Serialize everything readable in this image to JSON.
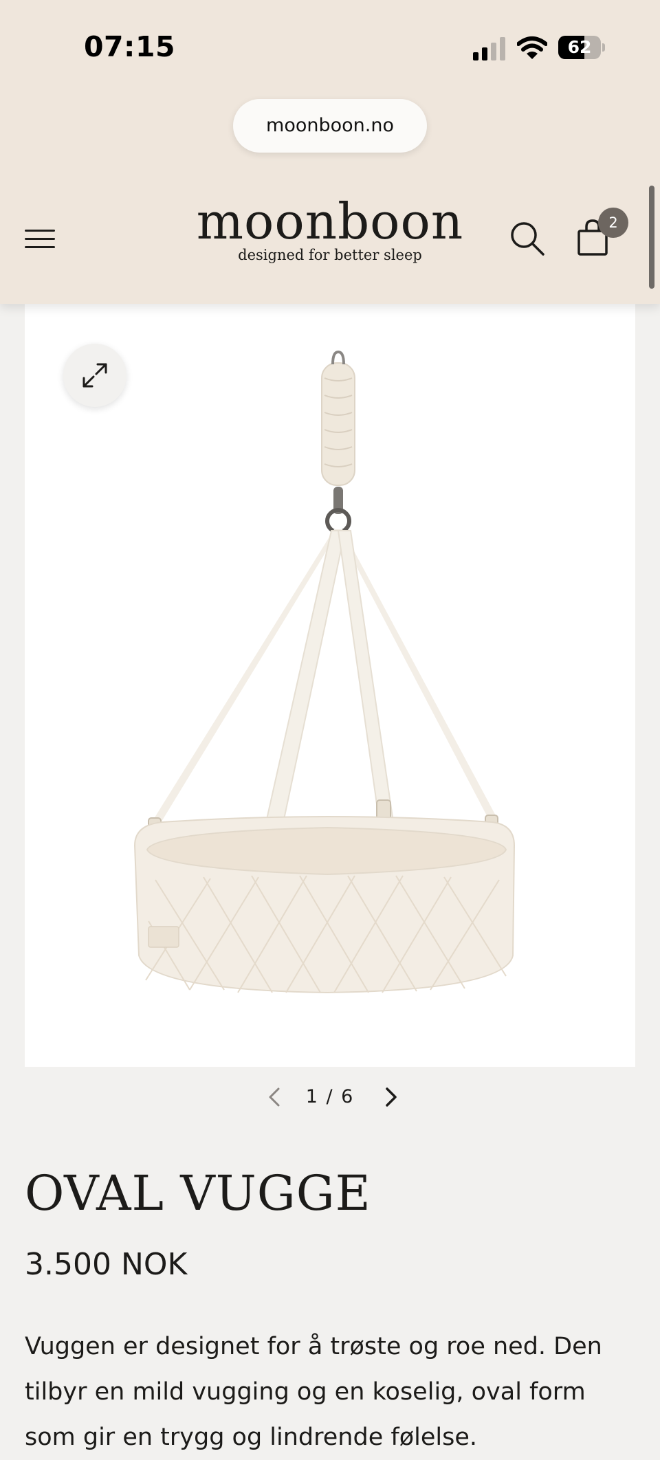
{
  "status_bar": {
    "time": "07:15",
    "battery": "62",
    "battery_level": 0.62
  },
  "browser": {
    "url": "moonboon.no"
  },
  "header": {
    "brand_name": "moonboon",
    "tagline": "designed for better sleep",
    "cart_count": "2",
    "icons": {
      "menu": "hamburger-menu-icon",
      "search": "search-icon",
      "cart": "shopping-bag-icon"
    }
  },
  "gallery": {
    "current": "1",
    "separator": "/",
    "total": "6",
    "pager_text": "1 / 6",
    "icons": {
      "expand": "expand-icon",
      "prev": "chevron-left-icon",
      "next": "chevron-right-icon"
    }
  },
  "product": {
    "title": "OVAL VUGGE",
    "price": "3.500 NOK",
    "description": "Vuggen er designet for å trøste og roe ned. Den tilbyr en mild vugging og en koselig, oval form som gir en trygg og lindrende følelse."
  },
  "colors": {
    "header_background": "#efe6dc",
    "page_background": "#f2f1ef",
    "text": "#1c1b19",
    "badge": "#6d6660"
  }
}
